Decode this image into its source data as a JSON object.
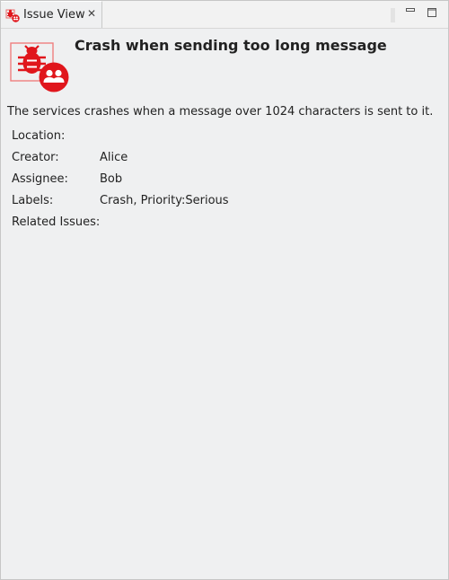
{
  "tab": {
    "title": "Issue View",
    "close_glyph": "✕",
    "icon": "bug-icon"
  },
  "window_controls": {
    "minimize_icon": "minimize-icon",
    "maximize_icon": "maximize-icon"
  },
  "issue": {
    "title": "Crash when sending too long message",
    "description": "The services crashes when a message over 1024 characters is sent to it.",
    "icon": "bug-with-users-icon",
    "accent_color": "#e0161c",
    "fields": [
      {
        "label": "Location:",
        "value": ""
      },
      {
        "label": "Creator:",
        "value": "Alice"
      },
      {
        "label": "Assignee:",
        "value": "Bob"
      },
      {
        "label": "Labels:",
        "value": "Crash, Priority:Serious"
      },
      {
        "label": "Related Issues:",
        "value": ""
      }
    ]
  }
}
